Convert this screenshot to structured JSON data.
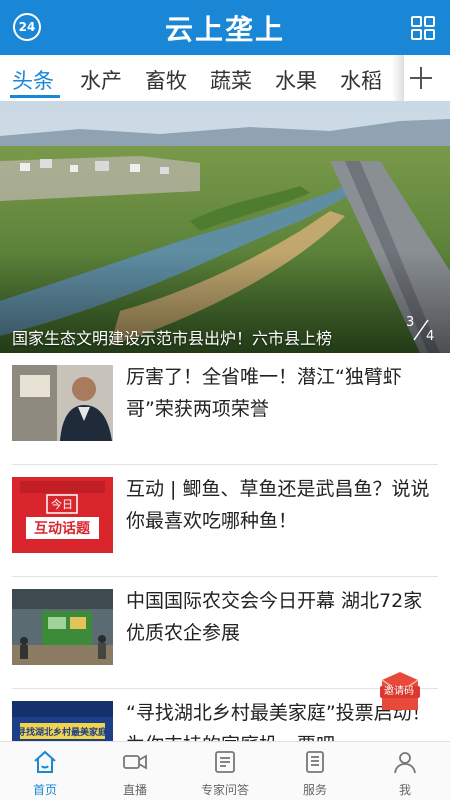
{
  "header": {
    "badge": "24",
    "title": "云上垄上"
  },
  "tabs": [
    {
      "label": "头条",
      "active": true
    },
    {
      "label": "水产",
      "active": false
    },
    {
      "label": "畜牧",
      "active": false
    },
    {
      "label": "蔬菜",
      "active": false
    },
    {
      "label": "水果",
      "active": false
    },
    {
      "label": "水稻",
      "active": false
    }
  ],
  "hero": {
    "caption": "国家生态文明建设示范市县出炉！六市县上榜",
    "page_current": "3",
    "page_total": "4"
  },
  "news": [
    {
      "title": "厉害了！全省唯一！潜江“独臂虾哥”荣获两项荣誉"
    },
    {
      "title": "互动 | 鲫鱼、草鱼还是武昌鱼？说说你最喜欢吃哪种鱼！",
      "thumb_text_1": "今日",
      "thumb_text_2": "互动话题"
    },
    {
      "title": "中国国际农交会今日开幕 湖北72家优质农企参展"
    },
    {
      "title": "“寻找湖北乡村最美家庭”投票启动！为你支持的家庭投一票吧",
      "thumb_text_1": "寻找湖北乡村最美家庭"
    }
  ],
  "invite": {
    "label": "邀请码"
  },
  "bottom_nav": [
    {
      "label": "首页",
      "icon": "home-icon",
      "active": true
    },
    {
      "label": "直播",
      "icon": "video-camera-icon",
      "active": false
    },
    {
      "label": "专家问答",
      "icon": "qa-document-icon",
      "active": false
    },
    {
      "label": "服务",
      "icon": "service-document-icon",
      "active": false
    },
    {
      "label": "我",
      "icon": "user-icon",
      "active": false
    }
  ],
  "colors": {
    "brand": "#1a86d6",
    "invite": "#e9493a"
  }
}
